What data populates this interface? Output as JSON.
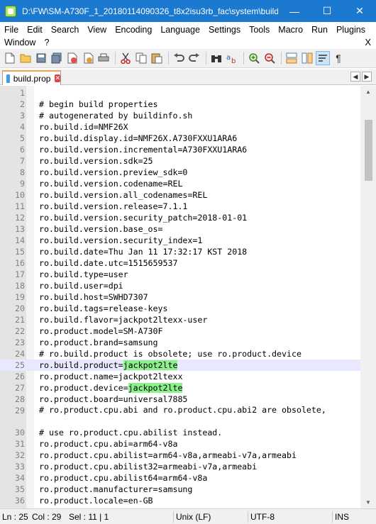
{
  "window": {
    "title": "D:\\FW\\SM-A730F_1_20180114090326_t8x2isu3rb_fac\\system\\build....",
    "minimize": "—",
    "maximize": "☐",
    "close": "✕"
  },
  "menu": {
    "items": [
      "File",
      "Edit",
      "Search",
      "View",
      "Encoding",
      "Language",
      "Settings",
      "Tools",
      "Macro",
      "Run",
      "Plugins"
    ],
    "items2": [
      "Window",
      "?"
    ],
    "close": "X"
  },
  "toolbar": {
    "icons": [
      "new-file-icon",
      "open-file-icon",
      "save-icon",
      "save-all-icon",
      "close-icon",
      "close-all-icon",
      "print-icon",
      "cut-icon",
      "copy-icon",
      "paste-icon",
      "undo-icon",
      "redo-icon",
      "find-icon",
      "replace-icon",
      "zoom-in-icon",
      "zoom-out-icon",
      "sync-v-icon",
      "sync-h-icon",
      "word-wrap-icon",
      "show-all-chars-icon"
    ]
  },
  "tabs": [
    {
      "label": "build.prop",
      "close": "✕"
    }
  ],
  "editor": {
    "current_line": 25,
    "lines": [
      {
        "n": "1",
        "t": ""
      },
      {
        "n": "2",
        "t": "# begin build properties"
      },
      {
        "n": "3",
        "t": "# autogenerated by buildinfo.sh"
      },
      {
        "n": "4",
        "t": "ro.build.id=NMF26X"
      },
      {
        "n": "5",
        "t": "ro.build.display.id=NMF26X.A730FXXU1ARA6"
      },
      {
        "n": "6",
        "t": "ro.build.version.incremental=A730FXXU1ARA6"
      },
      {
        "n": "7",
        "t": "ro.build.version.sdk=25"
      },
      {
        "n": "8",
        "t": "ro.build.version.preview_sdk=0"
      },
      {
        "n": "9",
        "t": "ro.build.version.codename=REL"
      },
      {
        "n": "10",
        "t": "ro.build.version.all_codenames=REL"
      },
      {
        "n": "11",
        "t": "ro.build.version.release=7.1.1"
      },
      {
        "n": "12",
        "t": "ro.build.version.security_patch=2018-01-01"
      },
      {
        "n": "13",
        "t": "ro.build.version.base_os="
      },
      {
        "n": "14",
        "t": "ro.build.version.security_index=1"
      },
      {
        "n": "15",
        "t": "ro.build.date=Thu Jan 11 17:32:17 KST 2018"
      },
      {
        "n": "16",
        "t": "ro.build.date.utc=1515659537"
      },
      {
        "n": "17",
        "t": "ro.build.type=user"
      },
      {
        "n": "18",
        "t": "ro.build.user=dpi"
      },
      {
        "n": "19",
        "t": "ro.build.host=SWHD7307"
      },
      {
        "n": "20",
        "t": "ro.build.tags=release-keys"
      },
      {
        "n": "21",
        "t": "ro.build.flavor=jackpot2ltexx-user"
      },
      {
        "n": "22",
        "t": "ro.product.model=SM-A730F"
      },
      {
        "n": "23",
        "t": "ro.product.brand=samsung"
      },
      {
        "n": "24",
        "t": "# ro.build.product is obsolete; use ro.product.device"
      },
      {
        "n": "25",
        "t": "ro.build.product=",
        "hl": "jackpot2lte"
      },
      {
        "n": "26",
        "t": "ro.product.name=jackpot2ltexx"
      },
      {
        "n": "27",
        "t": "ro.product.device=",
        "hl": "jackpot2lte"
      },
      {
        "n": "28",
        "t": "ro.product.board=universal7885"
      },
      {
        "n": "29",
        "t": "# ro.product.cpu.abi and ro.product.cpu.abi2 are obsolete,"
      },
      {
        "n": "30",
        "t": "# use ro.product.cpu.abilist instead."
      },
      {
        "n": "31",
        "t": "ro.product.cpu.abi=arm64-v8a"
      },
      {
        "n": "32",
        "t": "ro.product.cpu.abilist=arm64-v8a,armeabi-v7a,armeabi"
      },
      {
        "n": "33",
        "t": "ro.product.cpu.abilist32=armeabi-v7a,armeabi"
      },
      {
        "n": "34",
        "t": "ro.product.cpu.abilist64=arm64-v8a"
      },
      {
        "n": "35",
        "t": "ro.product.manufacturer=samsung"
      },
      {
        "n": "36",
        "t": "ro.product.locale=en-GB"
      }
    ]
  },
  "status": {
    "ln": "Ln : 25",
    "col": "Col : 29",
    "sel": "Sel : 11 | 1",
    "eol": "Unix (LF)",
    "encoding": "UTF-8",
    "mode": "INS"
  },
  "colors": {
    "titlebar": "#1b79d0",
    "highlight": "#8cf08c",
    "current_line": "#e8e8ff",
    "gutter": "#e4e4e4"
  }
}
